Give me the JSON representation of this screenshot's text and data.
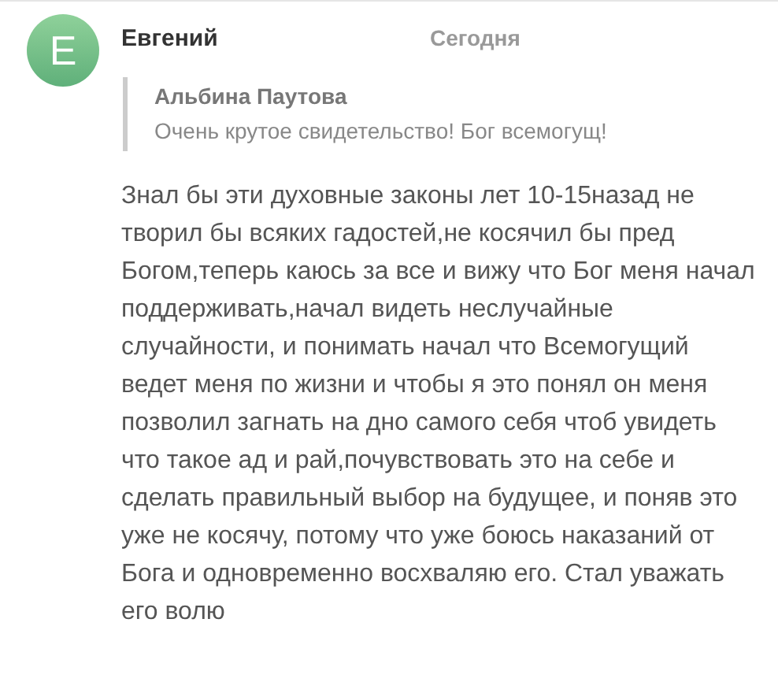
{
  "comment": {
    "avatar_letter": "E",
    "author": "Евгений",
    "date": "Сегодня",
    "quote": {
      "author": "Альбина Паутова",
      "text": "Очень крутое свидетельство! Бог всемогущ!"
    },
    "text": "Знал бы эти духовные законы лет 10-15назад не творил бы всяких гадостей,не косячил бы пред Богом,теперь каюсь за все и вижу что Бог меня начал поддерживать,начал видеть неслучайные случайности, и понимать начал что Всемогущий ведет меня по жизни и чтобы я это понял он меня позволил загнать на дно самого себя чтоб увидеть что такое ад и рай,почувствовать это на себе и сделать правильный выбор на будущее, и поняв это уже не косячу, потому что уже боюсь наказаний от Бога и одновременно восхваляю его. Стал уважать его волю"
  }
}
